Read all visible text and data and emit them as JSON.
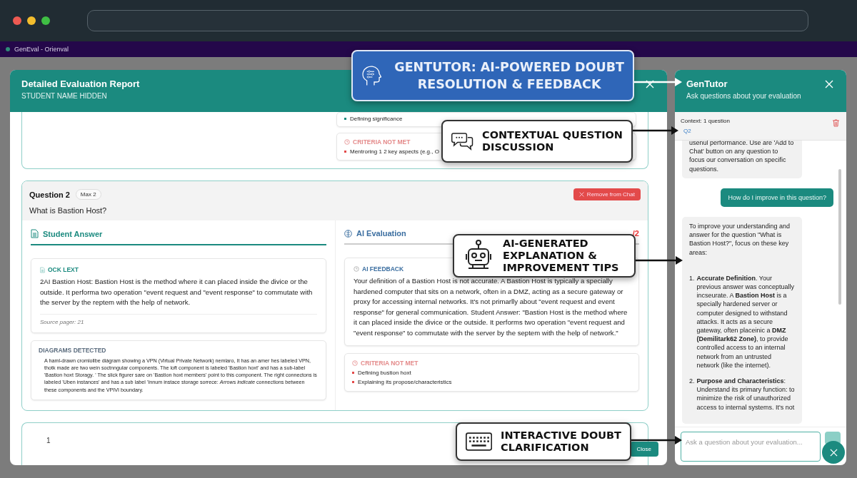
{
  "browser": {
    "tab_title": "GenEval - Orienval"
  },
  "report": {
    "title": "Detailed Evaluation Report",
    "subtitle": "STUDENT NAME HIDDEN",
    "previous_card": {
      "met_items": [
        "Defining significance"
      ],
      "not_met": {
        "heading": "CRITERIA NOT MET",
        "items": [
          "Mentroring 1 2 key aspects (e.g., O"
        ]
      }
    },
    "question": {
      "title": "Question 2",
      "max": "Max 2",
      "remove_button": "Remove from Chat",
      "text": "What is Bastion Host?",
      "student_answer": {
        "heading": "Student Answer",
        "ocr_label": "OCK LEXT",
        "ocr_text": "2AI Bastion Host: Bastion Host is the method where it can placed inside the divice or the outside. It performa two operation \"event request and \"event response\" to commutate with the server by the reptem with the help of network.",
        "source": "Source pager: 21",
        "diagrams_heading": "DIAGRAMS DETECTED",
        "diagrams": [
          "A haml-drawn cromlollbe diágram showing a VPN (Virtual Private Network) nemlaro, It has an amer hes labeled  VPN,  thotk made are two wein soctnngular components. The loft component is labeled 'Bastion hoxt' and has a sub-label 'Bastion hoxt Storagy. ' The slick figurer sare on 'Bastion hoxt members' point to this component. The right connectons is labeled 'Uben instances' and has a sub label 'Innum instace storage sorrece: *Arrows indicate* connections between these components and the VPIVI boundary."
        ]
      },
      "ai_evaluation": {
        "heading": "AI Evaluation",
        "score": "/2",
        "feedback_label": "AI FEEDBACK",
        "feedback": "Your definition of a Bastion Host is not accurate. A Bastion Host is typically a specially hardened computer that sits on a network, often in a DMZ, acting as a secure gateway or proxy for accessing internal networks. It's not primarlly about \"event request and event response\" for general communication. Student Answer: \"Bastion Host is the method where it can placed inside the divice or the outside. It performs two operation \"event request and \"event response\" to commutate with the server by the septem with the help of network.\"",
        "not_met": {
          "heading": "CRITERIA NOT MET",
          "items": [
            "Defining bustion hoxt",
            "Explaining its propose/characteristics"
          ]
        }
      }
    },
    "next_card": {
      "number": "1"
    },
    "close_button": "Close"
  },
  "chat": {
    "title": "GenTutor",
    "subtitle": "Ask questions about your evaluation",
    "context_label": "Context: 1 question",
    "context_items": [
      "Q2"
    ],
    "messages": [
      {
        "kind": "bot",
        "paragraphs": [
          "usenul performance. Use are 'Add to Chat' button on any question to focus our conversation on specific questions."
        ]
      },
      {
        "kind": "user",
        "paragraphs": [
          "How do I improve in this question?"
        ]
      },
      {
        "kind": "bot",
        "paragraphs": [
          "To improve your understanding and answer for the question \"What is Bastion Host?\", focus on these key areas:"
        ],
        "list": [
          {
            "marker": "1.",
            "text": "**Accurate Definition**. Your previous answer was conceptually incseurate. A **Bastion Host** is a specially hardened server or computer designed to withstand attacks. It acts as a secure gateway, often placeinic a **DMZ (Demilitark62 Zone)**, to provide controlled access to an internal network from an untrusted network (like the internet)."
          },
          {
            "marker": "2.",
            "text": "**Purpose and Characteristics**: Understand its primary function: to minimize the risk of unauthorized access to internal systems. It's not"
          }
        ]
      }
    ],
    "input_placeholder": "Ask a question about your evaluation..."
  },
  "callouts": [
    {
      "kind": "primary",
      "lines": [
        "GENTUTOR: AI-POWERED DOUBT",
        "RESOLUTION & FEEDBACK"
      ]
    },
    {
      "kind": "note",
      "lines": [
        "CONTEXTUAL QUESTION",
        "DISCUSSION"
      ]
    },
    {
      "kind": "note",
      "lines": [
        "AI-GENERATED",
        "EXPLANATION &",
        "IMPROVEMENT TIPS"
      ]
    },
    {
      "kind": "note",
      "lines": [
        "INTERACTIVE DOUBT",
        "CLARIFICATION"
      ]
    }
  ]
}
